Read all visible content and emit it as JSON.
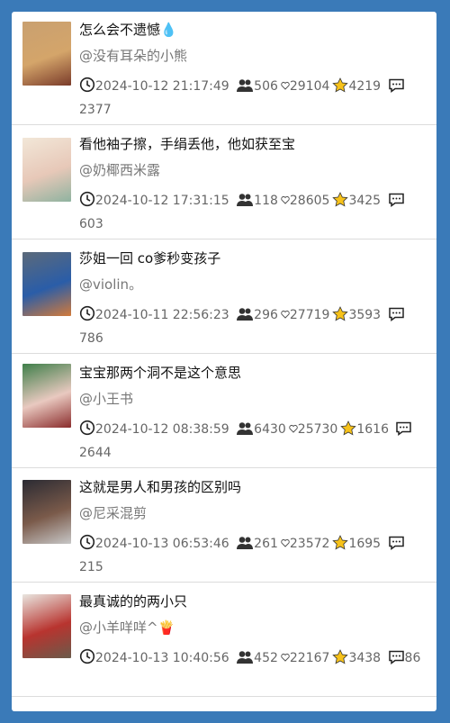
{
  "posts": [
    {
      "title": "怎么会不遗憾💧",
      "author": "@没有耳朵的小熊",
      "time": "2024-10-12 21:17:49",
      "views": "506",
      "likes": "29104",
      "favs": "4219",
      "comments": "2377",
      "thumb_colors": [
        "#c9a070",
        "#d4a56a",
        "#7a3b2a"
      ]
    },
    {
      "title": "看他袖子擦，手绢丢他，他如获至宝",
      "author": "@奶椰西米露",
      "time": "2024-10-12 17:31:15",
      "views": "118",
      "likes": "28605",
      "favs": "3425",
      "comments": "603",
      "thumb_colors": [
        "#f2e7d8",
        "#e7c8b8",
        "#8fb3a0"
      ]
    },
    {
      "title": "莎姐一回 co爹秒变孩子",
      "author": "@violin。",
      "time": "2024-10-11 22:56:23",
      "views": "296",
      "likes": "27719",
      "favs": "3593",
      "comments": "786",
      "thumb_colors": [
        "#5c6a7a",
        "#2a5da8",
        "#d27a3a"
      ]
    },
    {
      "title": "宝宝那两个洞不是这个意思",
      "author": "@小王书",
      "time": "2024-10-12 08:38:59",
      "views": "6430",
      "likes": "25730",
      "favs": "1616",
      "comments": "2644",
      "thumb_colors": [
        "#3f7f4a",
        "#e9c9c0",
        "#8a2c2c"
      ]
    },
    {
      "title": "这就是男人和男孩的区别吗",
      "author": "@尼采混剪",
      "time": "2024-10-13 06:53:46",
      "views": "261",
      "likes": "23572",
      "favs": "1695",
      "comments": "215",
      "thumb_colors": [
        "#2b2b33",
        "#7a5a4a",
        "#c7c7c7"
      ]
    },
    {
      "title": "最真诚的的两小只",
      "author": "@小羊咩咩^🍟",
      "time": "2024-10-13 10:40:56",
      "views": "452",
      "likes": "22167",
      "favs": "3438",
      "comments": "86",
      "thumb_colors": [
        "#e9e6e0",
        "#b8342f",
        "#6a5a4a"
      ]
    }
  ]
}
